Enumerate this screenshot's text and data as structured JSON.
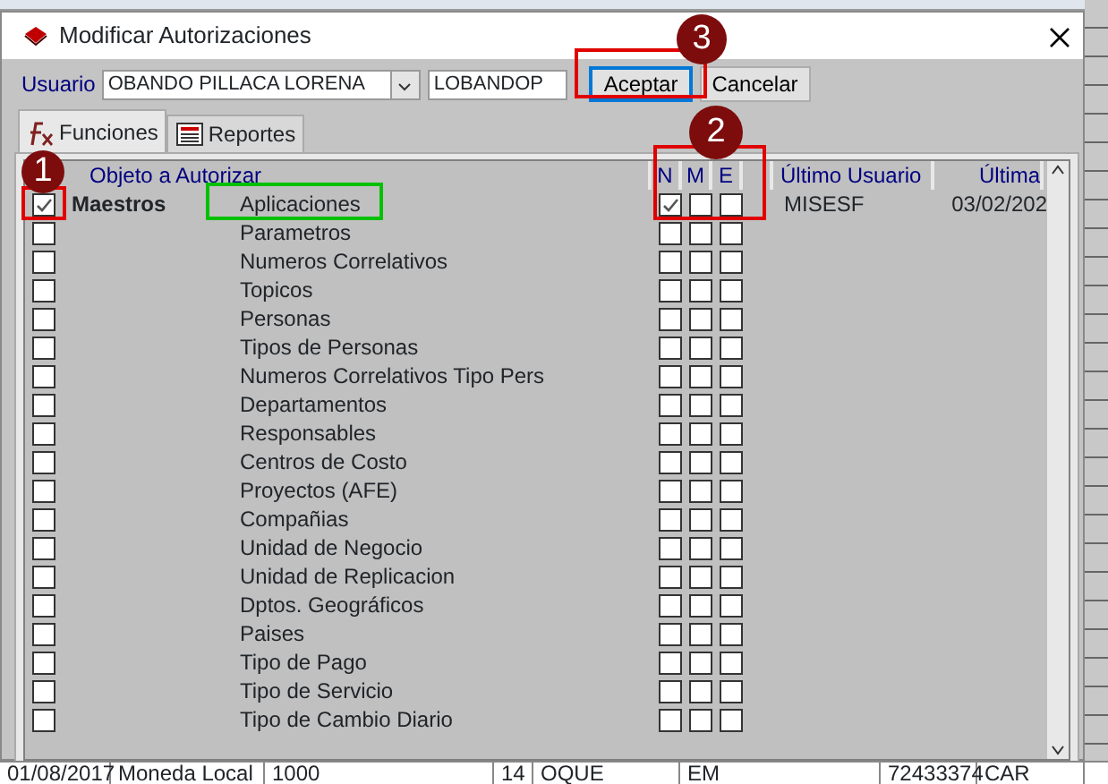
{
  "window": {
    "title": "Modificar Autorizaciones"
  },
  "user_bar": {
    "label": "Usuario",
    "user_name": "OBANDO PILLACA LORENA",
    "login": "LOBANDOP"
  },
  "buttons": [
    {
      "label": "Aceptar",
      "focused": true
    },
    {
      "label": "Cancelar",
      "focused": false
    }
  ],
  "tabs": [
    {
      "label": "Funciones",
      "selected": true
    },
    {
      "label": "Reportes",
      "selected": false
    }
  ],
  "table": {
    "columns": [
      "Objeto a Autorizar",
      "N",
      "M",
      "E",
      "Último Usuario",
      "Última"
    ],
    "rows": [
      {
        "checked": true,
        "group": "Maestros",
        "name": "Aplicaciones",
        "n": true,
        "m": false,
        "e": false,
        "user": "MISESF",
        "date": "03/02/202"
      },
      {
        "checked": false,
        "name": "Parametros",
        "n": false,
        "m": false,
        "e": false
      },
      {
        "checked": false,
        "name": "Numeros Correlativos",
        "n": false,
        "m": false,
        "e": false
      },
      {
        "checked": false,
        "name": "Topicos",
        "n": false,
        "m": false,
        "e": false
      },
      {
        "checked": false,
        "name": "Personas",
        "n": false,
        "m": false,
        "e": false
      },
      {
        "checked": false,
        "name": "Tipos de Personas",
        "n": false,
        "m": false,
        "e": false
      },
      {
        "checked": false,
        "name": "Numeros Correlativos Tipo Pers",
        "n": false,
        "m": false,
        "e": false
      },
      {
        "checked": false,
        "name": "Departamentos",
        "n": false,
        "m": false,
        "e": false
      },
      {
        "checked": false,
        "name": "Responsables",
        "n": false,
        "m": false,
        "e": false
      },
      {
        "checked": false,
        "name": "Centros de Costo",
        "n": false,
        "m": false,
        "e": false
      },
      {
        "checked": false,
        "name": "Proyectos (AFE)",
        "n": false,
        "m": false,
        "e": false
      },
      {
        "checked": false,
        "name": "Compañias",
        "n": false,
        "m": false,
        "e": false
      },
      {
        "checked": false,
        "name": "Unidad de Negocio",
        "n": false,
        "m": false,
        "e": false
      },
      {
        "checked": false,
        "name": "Unidad de Replicacion",
        "n": false,
        "m": false,
        "e": false
      },
      {
        "checked": false,
        "name": "Dptos. Geográficos",
        "n": false,
        "m": false,
        "e": false
      },
      {
        "checked": false,
        "name": "Paises",
        "n": false,
        "m": false,
        "e": false
      },
      {
        "checked": false,
        "name": "Tipo de Pago",
        "n": false,
        "m": false,
        "e": false
      },
      {
        "checked": false,
        "name": "Tipo de Servicio",
        "n": false,
        "m": false,
        "e": false
      },
      {
        "checked": false,
        "name": "Tipo de Cambio Diario",
        "n": false,
        "m": false,
        "e": false
      }
    ]
  },
  "background_row": [
    "01/08/2017",
    "Moneda Local",
    "1000",
    "14",
    "OQUE",
    "EM",
    "72433374",
    "CAR"
  ],
  "annotation_boxes": [
    {
      "color": "#e00000"
    },
    {
      "color": "#e00000"
    },
    {
      "color": "#e00000"
    },
    {
      "color": "#00c000"
    }
  ],
  "annotation_markers": [
    {
      "number": "1"
    },
    {
      "number": "2"
    },
    {
      "number": "3"
    }
  ]
}
